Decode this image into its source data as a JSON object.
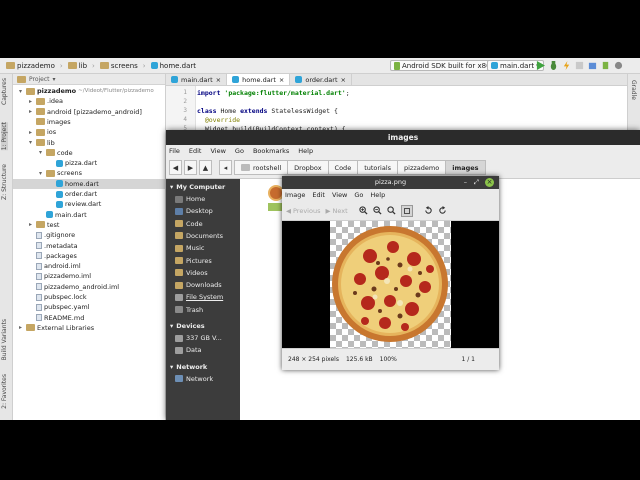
{
  "ide": {
    "breadcrumbs": [
      "pizzademo",
      "lib",
      "screens",
      "home.dart"
    ],
    "run_config": "Android SDK built for x86",
    "run_file": "main.dart",
    "tabs": [
      {
        "label": "main.dart",
        "active": false
      },
      {
        "label": "home.dart",
        "active": true
      },
      {
        "label": "order.dart",
        "active": false
      }
    ],
    "left_strip": [
      "Captures",
      "1: Project",
      "Z: Structure",
      "Build Variants",
      "2: Favorites"
    ],
    "right_strip": [
      "Gradle"
    ],
    "project_header": "Project",
    "tree": [
      {
        "label": "pizzademo",
        "extra": "~/Videot/Flutter/pizzademo",
        "indent": 0,
        "type": "folder",
        "arrow": "▾"
      },
      {
        "label": ".idea",
        "indent": 1,
        "type": "folder",
        "arrow": "▸"
      },
      {
        "label": "android [pizzademo_android]",
        "indent": 1,
        "type": "folder",
        "arrow": "▸"
      },
      {
        "label": "images",
        "indent": 1,
        "type": "folder",
        "arrow": ""
      },
      {
        "label": "ios",
        "indent": 1,
        "type": "folder",
        "arrow": "▸"
      },
      {
        "label": "lib",
        "indent": 1,
        "type": "folder",
        "arrow": "▾"
      },
      {
        "label": "code",
        "indent": 2,
        "type": "folder",
        "arrow": "▾"
      },
      {
        "label": "pizza.dart",
        "indent": 3,
        "type": "dart",
        "arrow": ""
      },
      {
        "label": "screens",
        "indent": 2,
        "type": "folder",
        "arrow": "▾"
      },
      {
        "label": "home.dart",
        "indent": 3,
        "type": "dart",
        "arrow": "",
        "selected": true
      },
      {
        "label": "order.dart",
        "indent": 3,
        "type": "dart",
        "arrow": ""
      },
      {
        "label": "review.dart",
        "indent": 3,
        "type": "dart",
        "arrow": ""
      },
      {
        "label": "main.dart",
        "indent": 2,
        "type": "dart",
        "arrow": ""
      },
      {
        "label": "test",
        "indent": 1,
        "type": "folder",
        "arrow": "▸"
      },
      {
        "label": ".gitignore",
        "indent": 1,
        "type": "file",
        "arrow": ""
      },
      {
        "label": ".metadata",
        "indent": 1,
        "type": "file",
        "arrow": ""
      },
      {
        "label": ".packages",
        "indent": 1,
        "type": "file",
        "arrow": ""
      },
      {
        "label": "android.iml",
        "indent": 1,
        "type": "file",
        "arrow": ""
      },
      {
        "label": "pizzademo.iml",
        "indent": 1,
        "type": "file",
        "arrow": ""
      },
      {
        "label": "pizzademo_android.iml",
        "indent": 1,
        "type": "file",
        "arrow": ""
      },
      {
        "label": "pubspec.lock",
        "indent": 1,
        "type": "file",
        "arrow": ""
      },
      {
        "label": "pubspec.yaml",
        "indent": 1,
        "type": "file",
        "arrow": ""
      },
      {
        "label": "README.md",
        "indent": 1,
        "type": "file",
        "arrow": ""
      },
      {
        "label": "External Libraries",
        "indent": 0,
        "type": "folder",
        "arrow": "▸"
      }
    ],
    "code": [
      {
        "num": "1",
        "parts": [
          [
            "kw",
            "import "
          ],
          [
            "str",
            "'package:flutter/material.dart'"
          ],
          [
            "",
            ";"
          ]
        ]
      },
      {
        "num": "2",
        "parts": [
          [
            "",
            ""
          ]
        ]
      },
      {
        "num": "3",
        "parts": [
          [
            "kw",
            "class "
          ],
          [
            "",
            "Home "
          ],
          [
            "kw",
            "extends "
          ],
          [
            "",
            "StatelessWidget {"
          ]
        ]
      },
      {
        "num": "4",
        "parts": [
          [
            "ann",
            "  @override"
          ]
        ]
      },
      {
        "num": "5",
        "parts": [
          [
            "",
            "  Widget build(BuildContext context) {"
          ]
        ]
      },
      {
        "num": "6",
        "parts": [
          [
            "kw",
            "    return new "
          ],
          [
            "",
            "Scaffold("
          ]
        ]
      }
    ]
  },
  "file_manager": {
    "title": "images",
    "menu": [
      "File",
      "Edit",
      "View",
      "Go",
      "Bookmarks",
      "Help"
    ],
    "path": [
      "rootshell",
      "Dropbox",
      "Code",
      "tutorials",
      "pizzademo",
      "images"
    ],
    "sidebar": [
      {
        "head": "My Computer",
        "items": [
          "Home",
          "Desktop",
          "Code",
          "Documents",
          "Music",
          "Pictures",
          "Videos",
          "Downloads",
          "File System",
          "Trash"
        ]
      },
      {
        "head": "Devices",
        "items": [
          "337 GB V...",
          "Data"
        ]
      },
      {
        "head": "Network",
        "items": [
          "Network"
        ]
      }
    ]
  },
  "image_viewer": {
    "title": "pizza.png",
    "menu": [
      "Image",
      "Edit",
      "View",
      "Go",
      "Help"
    ],
    "previous": "Previous",
    "next": "Next",
    "status": {
      "dims": "248 × 254 pixels",
      "size": "125.6 kB",
      "zoom": "100%",
      "index": "1 / 1"
    }
  }
}
